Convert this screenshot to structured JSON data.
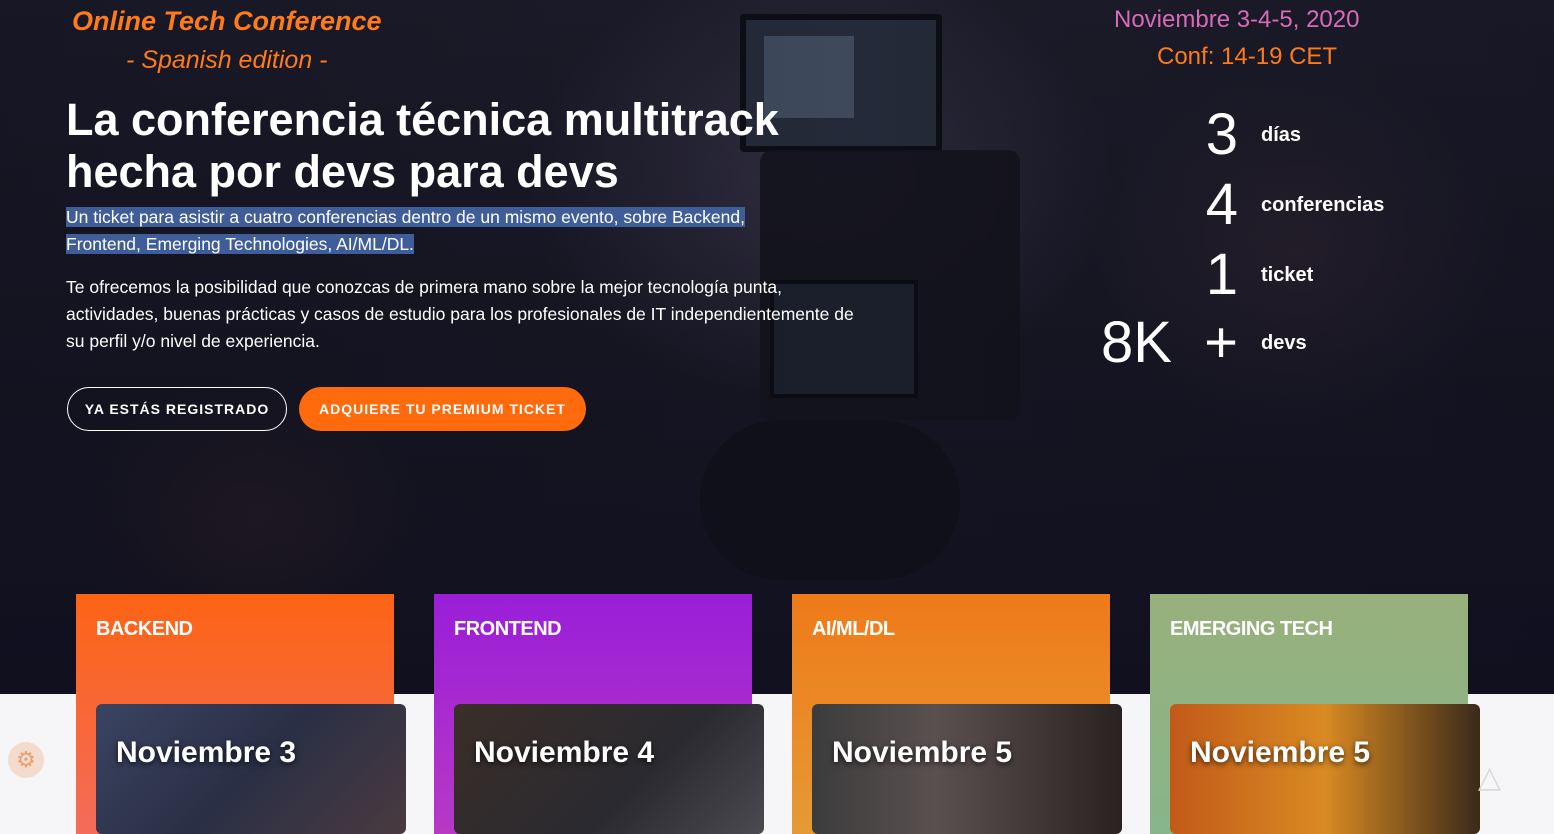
{
  "brand": {
    "title": "Online Tech Conference",
    "subtitle": "- Spanish edition -"
  },
  "event": {
    "dates": "Noviembre 3-4-5, 2020",
    "conf_time": "Conf: 14-19 CET"
  },
  "hero": {
    "headline": "La conferencia técnica multitrack hecha por devs para devs",
    "intro_line1": "Un ticket para asistir a cuatro conferencias dentro de un mismo evento, sobre Backend,",
    "intro_line2": "Frontend, Emerging Technologies, AI/ML/DL.",
    "description": "Te ofrecemos la posibilidad que conozcas de primera mano sobre la mejor tecnología punta, actividades, buenas prácticas y casos de estudio para los profesionales de IT independientemente de su perfil y/o nivel de experiencia."
  },
  "buttons": {
    "registered": "YA ESTÁS REGISTRADO",
    "premium": "ADQUIERE TU PREMIUM TICKET"
  },
  "stats": [
    {
      "number": "3",
      "label": "días"
    },
    {
      "number": "4",
      "label": "conferencias"
    },
    {
      "number": "1",
      "label": "ticket"
    },
    {
      "number": "8K  +",
      "label": "devs"
    }
  ],
  "tracks": [
    {
      "title": "BACKEND",
      "date": "Noviembre 3",
      "color": "#fc6414"
    },
    {
      "title": "FRONTEND",
      "date": "Noviembre 4",
      "color": "#9a1ed8"
    },
    {
      "title": "AI/ML/DL",
      "date": "Noviembre 5",
      "color": "#ef7a18"
    },
    {
      "title": "EMERGING TECH",
      "date": "Noviembre 5",
      "color": "#98b07c"
    }
  ],
  "icons": {
    "left_floating": "settings-gear-icon",
    "right_floating": "triangle-logo-icon"
  }
}
